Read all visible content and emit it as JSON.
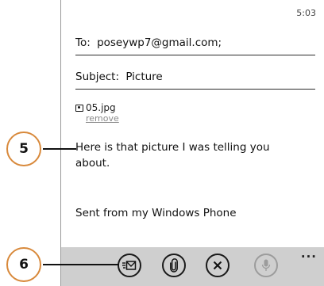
{
  "status": {
    "time": "5:03"
  },
  "email": {
    "to_label": "To:",
    "to_value": "poseywp7@gmail.com;",
    "subject_label": "Subject:",
    "subject_value": "Picture",
    "attachment_name": "05.jpg",
    "attachment_remove": "remove",
    "body_line1": "Here is that picture I was telling you",
    "body_line2": "about.",
    "signature": "Sent from my Windows Phone"
  },
  "app_bar": {
    "buttons": [
      {
        "name": "send",
        "icon": "send-mail-icon",
        "enabled": true
      },
      {
        "name": "attach",
        "icon": "paperclip-icon",
        "enabled": true
      },
      {
        "name": "discard",
        "icon": "close-icon",
        "enabled": true
      },
      {
        "name": "dictate",
        "icon": "microphone-icon",
        "enabled": false
      }
    ],
    "more": "..."
  },
  "callouts": {
    "c5": "5",
    "c6": "6"
  },
  "colors": {
    "callout_border": "#d8893b",
    "app_bar_bg": "#cfcfcf"
  }
}
